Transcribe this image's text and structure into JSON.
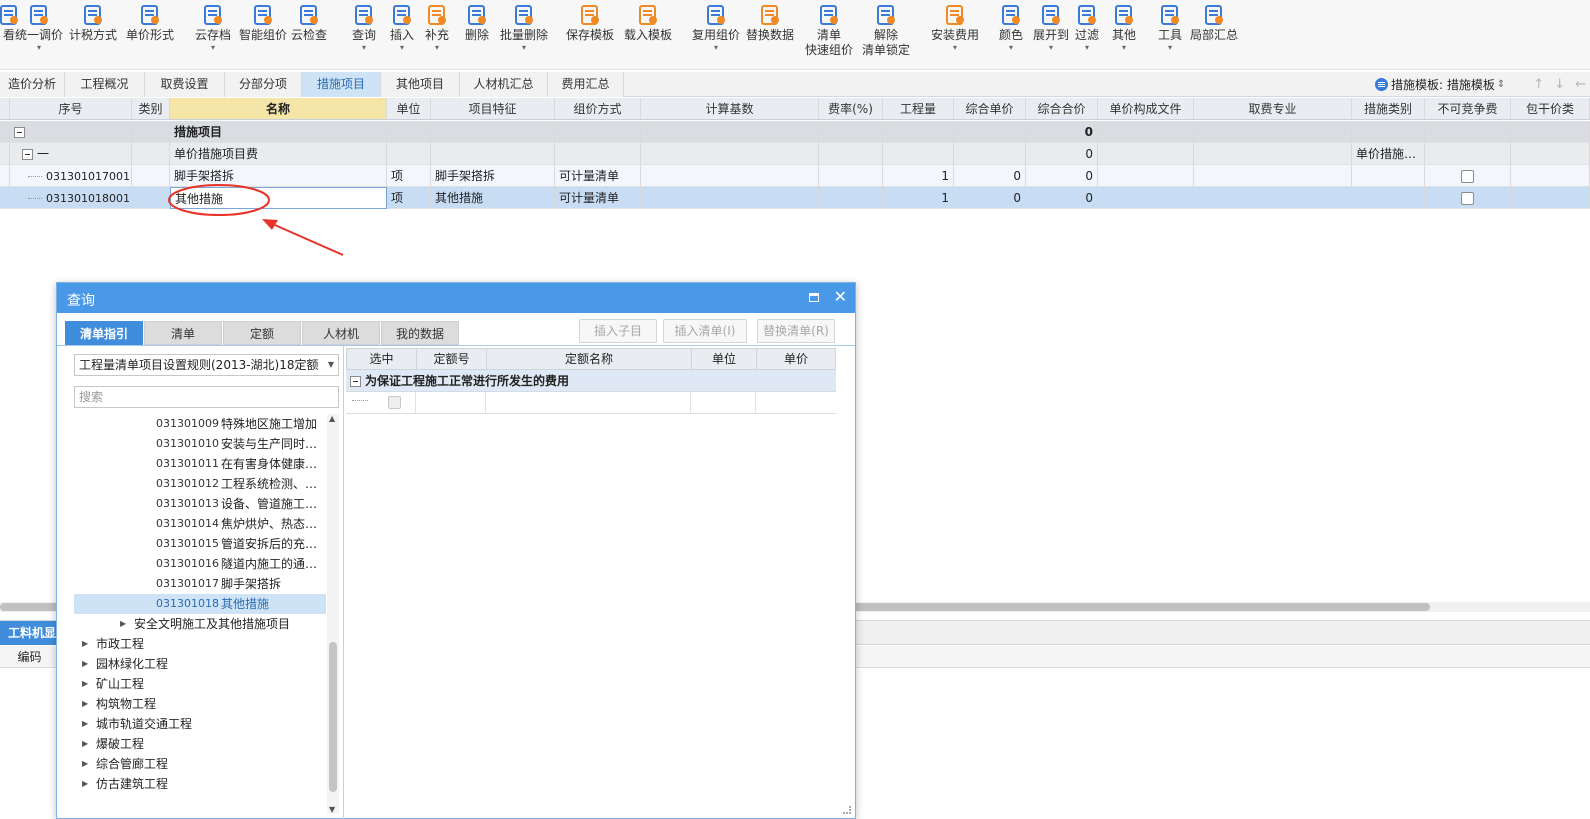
{
  "toolbar": {
    "items": [
      {
        "label": "看",
        "icon": "view-icon"
      },
      {
        "label": "统一调价",
        "icon": "unified-price-icon",
        "dropdown": true
      },
      {
        "label": "计税方式",
        "icon": "tax-method-icon"
      },
      {
        "label": "单价形式",
        "icon": "unit-price-form-icon"
      },
      {
        "label": "云存档",
        "icon": "cloud-archive-icon",
        "dropdown": true
      },
      {
        "label": "智能组价",
        "icon": "smart-pricing-icon"
      },
      {
        "label": "云检查",
        "icon": "cloud-check-icon"
      },
      {
        "label": "查询",
        "icon": "query-icon",
        "dropdown": true
      },
      {
        "label": "插入",
        "icon": "insert-icon",
        "dropdown": true
      },
      {
        "label": "补充",
        "icon": "supplement-icon",
        "dropdown": true
      },
      {
        "label": "删除",
        "icon": "delete-icon"
      },
      {
        "label": "批量删除",
        "icon": "batch-delete-icon",
        "dropdown": true
      },
      {
        "label": "保存模板",
        "icon": "save-template-icon"
      },
      {
        "label": "载入模板",
        "icon": "load-template-icon"
      },
      {
        "label": "复用组价",
        "icon": "reuse-pricing-icon",
        "dropdown": true
      },
      {
        "label": "替换数据",
        "icon": "replace-data-icon"
      },
      {
        "label": "清单",
        "label2": "快速组价",
        "icon": "quick-pricing-icon"
      },
      {
        "label": "解除",
        "label2": "清单锁定",
        "icon": "unlock-icon"
      },
      {
        "label": "安装费用",
        "icon": "install-fee-icon",
        "dropdown": true
      },
      {
        "label": "颜色",
        "icon": "color-icon",
        "dropdown": true
      },
      {
        "label": "展开到",
        "icon": "expand-to-icon",
        "dropdown": true
      },
      {
        "label": "过滤",
        "icon": "filter-icon",
        "dropdown": true
      },
      {
        "label": "其他",
        "icon": "other-icon",
        "dropdown": true
      },
      {
        "label": "工具",
        "icon": "tools-icon",
        "dropdown": true
      },
      {
        "label": "局部汇总",
        "icon": "partial-summary-icon"
      }
    ]
  },
  "tabs": [
    {
      "label": "造价分析"
    },
    {
      "label": "工程概况"
    },
    {
      "label": "取费设置"
    },
    {
      "label": "分部分项"
    },
    {
      "label": "措施项目",
      "active": true
    },
    {
      "label": "其他项目"
    },
    {
      "label": "人材机汇总"
    },
    {
      "label": "费用汇总"
    }
  ],
  "template_selector": {
    "label": "措施模板: 措施模板"
  },
  "grid": {
    "headers": [
      "序号",
      "类别",
      "名称",
      "单位",
      "项目特征",
      "组价方式",
      "计算基数",
      "费率(%)",
      "工程量",
      "综合单价",
      "综合合价",
      "单价构成文件",
      "取费专业",
      "措施类别",
      "不可竞争费",
      "包干价类"
    ],
    "rows": [
      {
        "type": "group",
        "seq": "",
        "cat": "",
        "name": "措施项目",
        "unit": "",
        "feature": "",
        "method": "",
        "base": "",
        "rate": "",
        "qty": "",
        "uprice": "",
        "total": "0",
        "file": "",
        "major": "",
        "mcat": "",
        "nc": false
      },
      {
        "type": "sub",
        "seq": "一",
        "cat": "",
        "name": "单价措施项目费",
        "unit": "",
        "feature": "",
        "method": "",
        "base": "",
        "rate": "",
        "qty": "",
        "uprice": "",
        "total": "0",
        "file": "",
        "major": "",
        "mcat": "单价措施…",
        "nc": false
      },
      {
        "type": "item",
        "seq": "031301017001",
        "cat": "",
        "name": "脚手架搭拆",
        "unit": "项",
        "feature": "脚手架搭拆",
        "method": "可计量清单",
        "base": "",
        "rate": "",
        "qty": "1",
        "uprice": "0",
        "total": "0",
        "file": "",
        "major": "",
        "mcat": "",
        "nc": true
      },
      {
        "type": "sel",
        "seq": "031301018001",
        "cat": "",
        "name": "其他措施",
        "unit": "项",
        "feature": "其他措施",
        "method": "可计量清单",
        "base": "",
        "rate": "",
        "qty": "1",
        "uprice": "0",
        "total": "0",
        "file": "",
        "major": "",
        "mcat": "",
        "nc": true
      }
    ]
  },
  "bottom": {
    "tab": "工料机显",
    "column": "编码"
  },
  "dialog": {
    "title": "查询",
    "tabs": [
      {
        "label": "清单指引",
        "active": true
      },
      {
        "label": "清单"
      },
      {
        "label": "定额"
      },
      {
        "label": "人材机"
      },
      {
        "label": "我的数据"
      }
    ],
    "actions": [
      "插入子目",
      "插入清单(I)",
      "替换清单(R)"
    ],
    "library": "工程量清单项目设置规则(2013-湖北)18定额",
    "search_placeholder": "搜索",
    "tree": [
      {
        "code": "031301009",
        "name": "特殊地区施工增加"
      },
      {
        "code": "031301010",
        "name": "安装与生产同时…"
      },
      {
        "code": "031301011",
        "name": "在有害身体健康…"
      },
      {
        "code": "031301012",
        "name": "工程系统检测、…"
      },
      {
        "code": "031301013",
        "name": "设备、管道施工…"
      },
      {
        "code": "031301014",
        "name": "焦炉烘炉、热态…"
      },
      {
        "code": "031301015",
        "name": "管道安拆后的充…"
      },
      {
        "code": "031301016",
        "name": "隧道内施工的通…"
      },
      {
        "code": "031301017",
        "name": "脚手架搭拆"
      },
      {
        "code": "031301018",
        "name": "其他措施",
        "selected": true
      }
    ],
    "tree_groups": [
      {
        "label": "安全文明施工及其他措施项目",
        "indent": 2
      },
      {
        "label": "市政工程",
        "indent": 1
      },
      {
        "label": "园林绿化工程",
        "indent": 1
      },
      {
        "label": "矿山工程",
        "indent": 1
      },
      {
        "label": "构筑物工程",
        "indent": 1
      },
      {
        "label": "城市轨道交通工程",
        "indent": 1
      },
      {
        "label": "爆破工程",
        "indent": 1
      },
      {
        "label": "综合管廊工程",
        "indent": 1
      },
      {
        "label": "仿古建筑工程",
        "indent": 1
      }
    ],
    "result_headers": [
      "选中",
      "定额号",
      "定额名称",
      "单位",
      "单价"
    ],
    "result_group": "为保证工程施工正常进行所发生的费用"
  },
  "colors": {
    "accent": "#4a98e8",
    "tab_active_bg": "#cfe3f7",
    "annotation": "#e8332a"
  }
}
